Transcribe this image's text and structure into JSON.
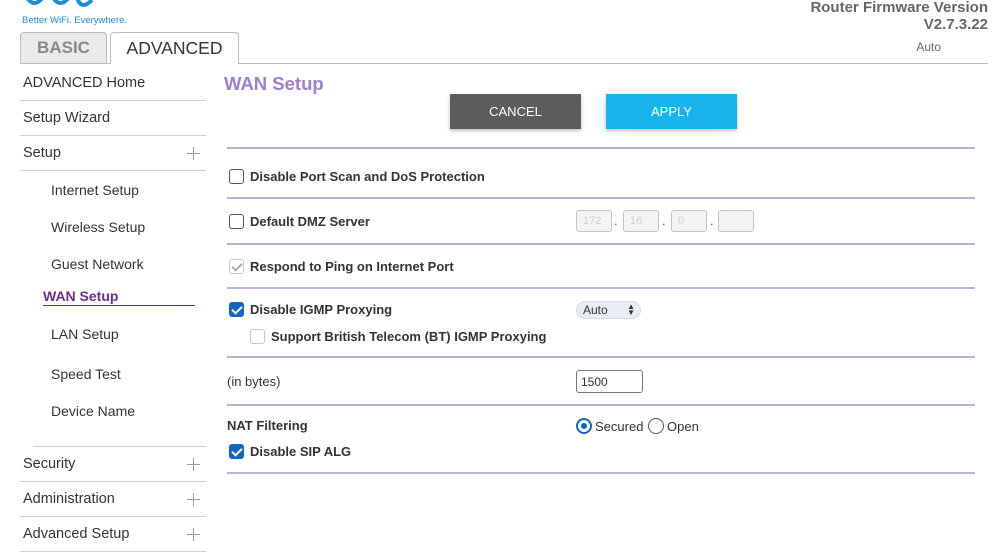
{
  "brand": {
    "tagline": "Better WiFi. Everywhere.",
    "accent": "#19b3ec"
  },
  "firmware": {
    "label": "Router Firmware Version",
    "version": "V2.7.3.22",
    "mode": "Auto"
  },
  "tabs": [
    {
      "label": "BASIC",
      "active": false
    },
    {
      "label": "ADVANCED",
      "active": true
    }
  ],
  "sidebar": {
    "top_items": [
      {
        "label": "ADVANCED Home",
        "expandable": false
      },
      {
        "label": "Setup Wizard",
        "expandable": false
      },
      {
        "label": "Setup",
        "expandable": true
      }
    ],
    "setup_subitems": [
      {
        "label": "Internet Setup",
        "active": false
      },
      {
        "label": "Wireless Setup",
        "active": false
      },
      {
        "label": "Guest Network",
        "active": false
      },
      {
        "label": "WAN Setup",
        "active": true
      },
      {
        "label": "LAN Setup",
        "active": false
      },
      {
        "label": "Speed Test",
        "active": false
      },
      {
        "label": "Device Name",
        "active": false
      }
    ],
    "bottom_items": [
      {
        "label": "Security",
        "expandable": true
      },
      {
        "label": "Administration",
        "expandable": true
      },
      {
        "label": "Advanced Setup",
        "expandable": true
      }
    ]
  },
  "main": {
    "title": "WAN Setup",
    "cancel_label": "CANCEL",
    "apply_label": "APPLY",
    "options": {
      "port_scan": {
        "label": "Disable Port Scan and DoS Protection",
        "checked": false
      },
      "dmz": {
        "label": "Default DMZ Server",
        "checked": false,
        "ip": [
          "172",
          "16",
          "0",
          ""
        ]
      },
      "ping": {
        "label": "Respond to Ping on Internet Port",
        "checked": true,
        "disabled": true
      },
      "igmp": {
        "label": "Disable IGMP Proxying",
        "checked": true,
        "select_value": "Auto"
      },
      "bt_igmp": {
        "label": "Support British Telecom (BT) IGMP Proxying",
        "checked": false
      },
      "mtu": {
        "label": "(in bytes)",
        "value": "1500"
      },
      "nat": {
        "label": "NAT Filtering",
        "secured_label": "Secured",
        "open_label": "Open",
        "selected": "Secured"
      },
      "sip": {
        "label": "Disable SIP ALG",
        "checked": true
      }
    }
  }
}
